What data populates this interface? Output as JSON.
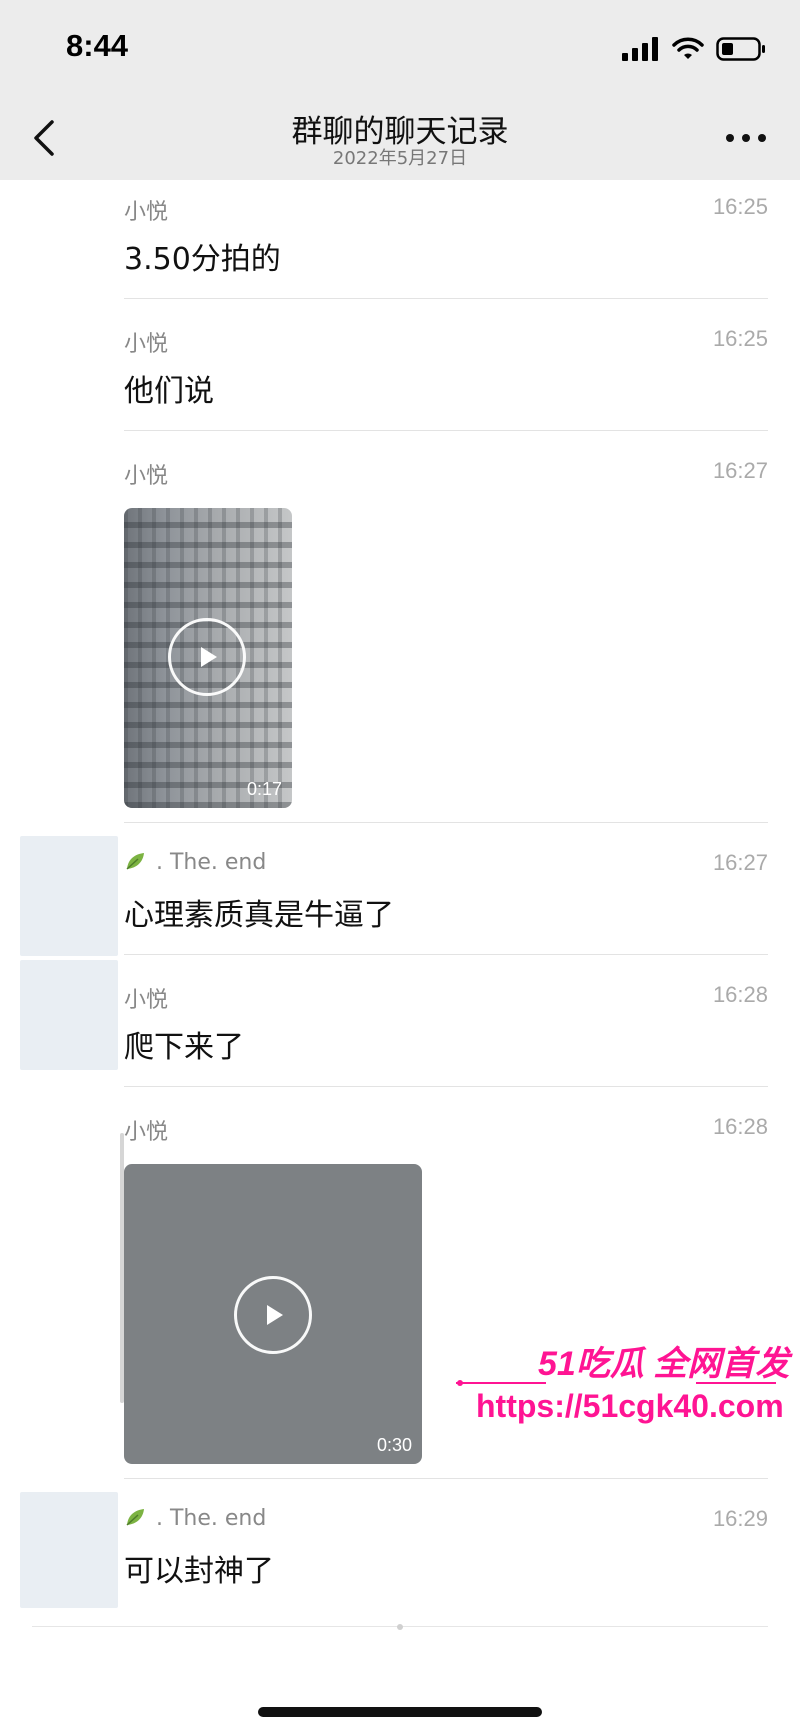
{
  "status_bar": {
    "time": "8:44"
  },
  "nav": {
    "title": "群聊的聊天记录",
    "subtitle": "2022年5月27日"
  },
  "messages": [
    {
      "sender": "小悦",
      "time": "16:25",
      "text": "3.50分拍的"
    },
    {
      "sender": "小悦",
      "time": "16:25",
      "text": "他们说"
    },
    {
      "sender": "小悦",
      "time": "16:27",
      "video_duration": "0:17"
    },
    {
      "sender": ". The. end",
      "time": "16:27",
      "text": "心理素质真是牛逼了"
    },
    {
      "sender": "小悦",
      "time": "16:28",
      "text": "爬下来了"
    },
    {
      "sender": "小悦",
      "time": "16:28",
      "video_duration": "0:30"
    },
    {
      "sender": ". The. end",
      "time": "16:29",
      "text": "可以封神了"
    }
  ],
  "watermark": {
    "line1": "51吃瓜 全网首发",
    "url": "https://51cgk40.com"
  },
  "colors": {
    "watermark": "#ff1493",
    "nav_bg": "#ececec"
  }
}
